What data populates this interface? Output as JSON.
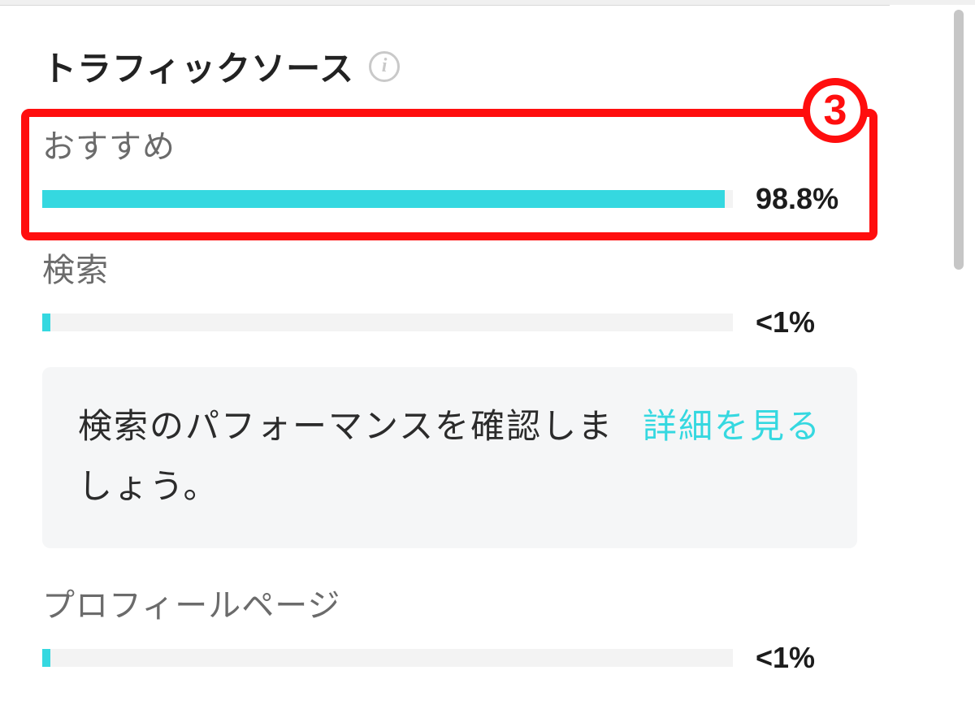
{
  "section_title": "トラフィックソース",
  "sources": [
    {
      "label": "おすすめ",
      "percent": 98.8,
      "display": "98.8%"
    },
    {
      "label": "検索",
      "percent": 1,
      "display": "<1%"
    },
    {
      "label": "プロフィールページ",
      "percent": 1,
      "display": "<1%"
    }
  ],
  "promo": {
    "text": "検索のパフォーマンスを確認しましょう。",
    "link_label": "詳細を見る"
  },
  "annotation": {
    "badge": "3"
  },
  "colors": {
    "accent": "#35d8e0",
    "highlight": "#ff0e0e"
  },
  "chart_data": {
    "type": "bar",
    "title": "トラフィックソース",
    "categories": [
      "おすすめ",
      "検索",
      "プロフィールページ"
    ],
    "values": [
      98.8,
      1,
      1
    ],
    "display_values": [
      "98.8%",
      "<1%",
      "<1%"
    ],
    "xlabel": "",
    "ylabel": "",
    "ylim": [
      0,
      100
    ]
  }
}
